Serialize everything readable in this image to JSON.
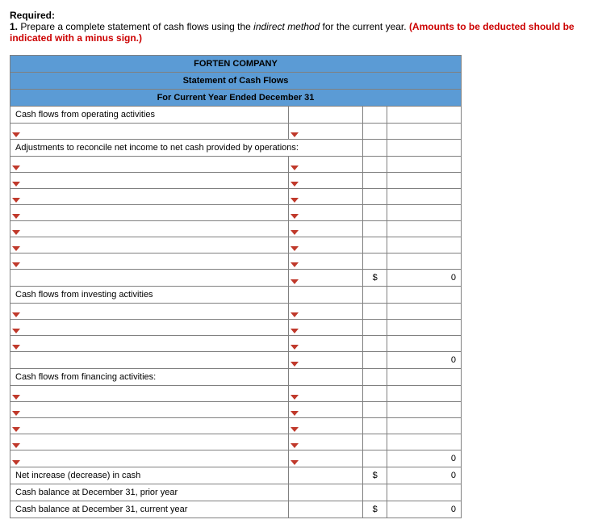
{
  "heading": {
    "required_label": "Required:",
    "item_number": "1.",
    "text_before_ital": " Prepare a complete statement of cash flows using the ",
    "ital": "indirect method",
    "text_after_ital": " for the current year. ",
    "red_text": "(Amounts to be deducted should be indicated with a minus sign.)"
  },
  "table": {
    "company": "FORTEN COMPANY",
    "title": "Statement of Cash Flows",
    "period": "For Current Year Ended December 31",
    "sections": {
      "operating": "Cash flows from operating activities",
      "adjustments": "Adjustments to reconcile net income to net cash provided by operations:",
      "investing": "Cash flows from investing activities",
      "financing": "Cash flows from financing activities:",
      "net_increase": "Net increase (decrease) in cash",
      "balance_prior": "Cash balance at December 31, prior year",
      "balance_current": "Cash balance at December 31, current year"
    },
    "values": {
      "operating_total": "0",
      "investing_total": "0",
      "financing_total": "0",
      "net_increase": "0",
      "balance_current": "0",
      "dollar": "$"
    }
  }
}
